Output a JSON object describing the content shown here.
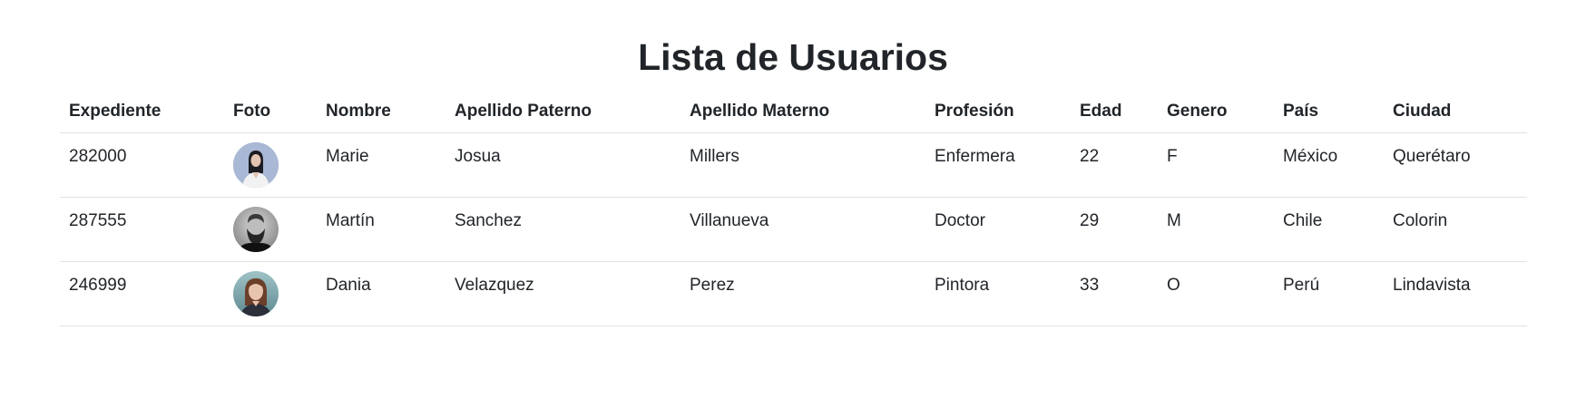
{
  "title": "Lista de Usuarios",
  "table": {
    "headers": [
      "Expediente",
      "Foto",
      "Nombre",
      "Apellido Paterno",
      "Apellido Materno",
      "Profesión",
      "Edad",
      "Genero",
      "País",
      "Ciudad"
    ],
    "rows": [
      {
        "expediente": "282000",
        "foto": "avatar-woman-dark-hair",
        "nombre": "Marie",
        "apellido_paterno": "Josua",
        "apellido_materno": "Millers",
        "profesion": "Enfermera",
        "edad": "22",
        "genero": "F",
        "pais": "México",
        "ciudad": "Querétaro"
      },
      {
        "expediente": "287555",
        "foto": "avatar-bearded-man",
        "nombre": "Martín",
        "apellido_paterno": "Sanchez",
        "apellido_materno": "Villanueva",
        "profesion": "Doctor",
        "edad": "29",
        "genero": "M",
        "pais": "Chile",
        "ciudad": "Colorin"
      },
      {
        "expediente": "246999",
        "foto": "avatar-woman-auburn-hair",
        "nombre": "Dania",
        "apellido_paterno": "Velazquez",
        "apellido_materno": "Perez",
        "profesion": "Pintora",
        "edad": "33",
        "genero": "O",
        "pais": "Perú",
        "ciudad": "Lindavista"
      }
    ]
  }
}
